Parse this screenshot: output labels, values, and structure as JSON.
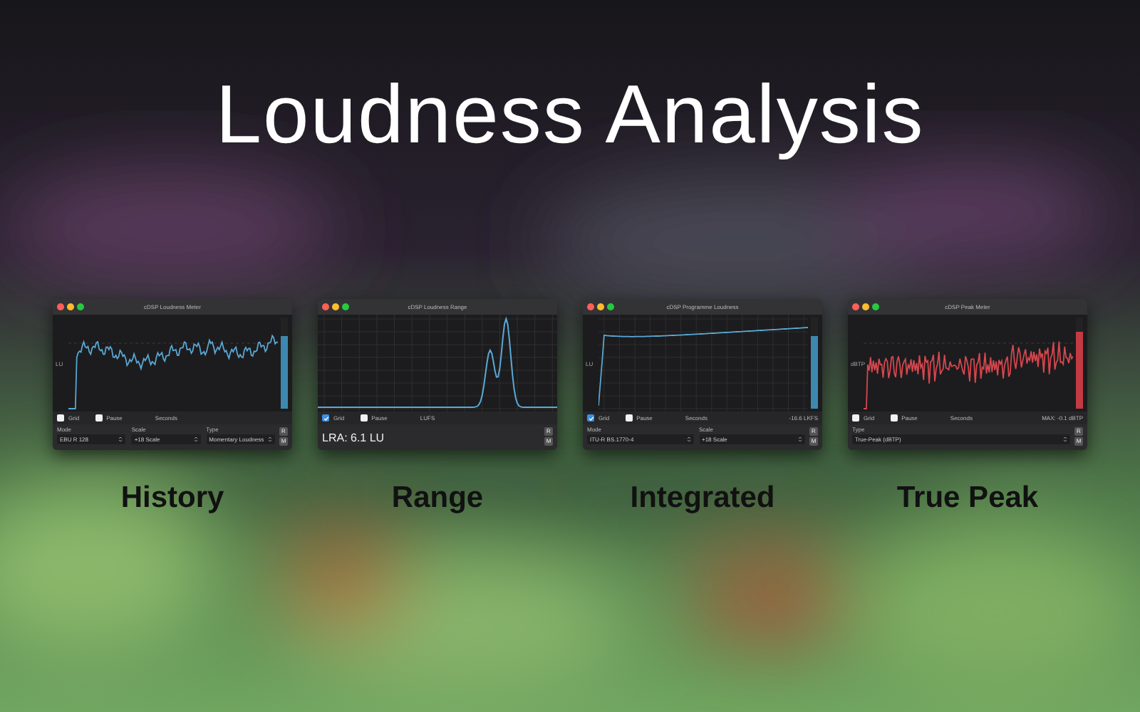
{
  "title": "Loudness Analysis",
  "panels": [
    {
      "kind": "history",
      "window_title": "cDSP Loudness Meter",
      "axis_label": "LU",
      "x_label": "Seconds",
      "grid": {
        "label": "Grid",
        "checked": false
      },
      "pause": {
        "label": "Pause",
        "checked": false
      },
      "meter": {
        "level": 0.8
      },
      "controls": [
        {
          "label": "Mode",
          "value": "EBU R 128"
        },
        {
          "label": "Scale",
          "value": "+18 Scale"
        },
        {
          "label": "Type",
          "value": "Momentary Loudness"
        }
      ],
      "side_buttons": [
        "R",
        "M"
      ],
      "caption": "History"
    },
    {
      "kind": "range",
      "window_title": "cDSP Loudness Range",
      "x_label": "LUFS",
      "grid": {
        "label": "Grid",
        "checked": true
      },
      "pause": {
        "label": "Pause",
        "checked": false
      },
      "summary": "LRA: 6.1 LU",
      "side_buttons": [
        "R",
        "M"
      ],
      "caption": "Range"
    },
    {
      "kind": "integrated",
      "window_title": "cDSP Programme Loudness",
      "axis_label": "LU",
      "x_label": "Seconds",
      "readout": "-16.6 LKFS",
      "grid": {
        "label": "Grid",
        "checked": true
      },
      "pause": {
        "label": "Pause",
        "checked": false
      },
      "meter": {
        "level": 0.8
      },
      "controls": [
        {
          "label": "Mode",
          "value": "ITU-R BS.1770-4"
        },
        {
          "label": "Scale",
          "value": "+18 Scale"
        }
      ],
      "side_buttons": [
        "R",
        "M"
      ],
      "caption": "Integrated"
    },
    {
      "kind": "peak",
      "window_title": "cDSP Peak Meter",
      "axis_label": "dBTP",
      "x_label": "Seconds",
      "readout": "MAX: -0.1 dBTP",
      "grid": {
        "label": "Grid",
        "checked": false
      },
      "pause": {
        "label": "Pause",
        "checked": false
      },
      "meter": {
        "level": 0.85
      },
      "controls": [
        {
          "label": "Type",
          "value": "True-Peak (dBTP)"
        }
      ],
      "side_buttons": [
        "R",
        "M"
      ],
      "caption": "True Peak"
    }
  ]
}
